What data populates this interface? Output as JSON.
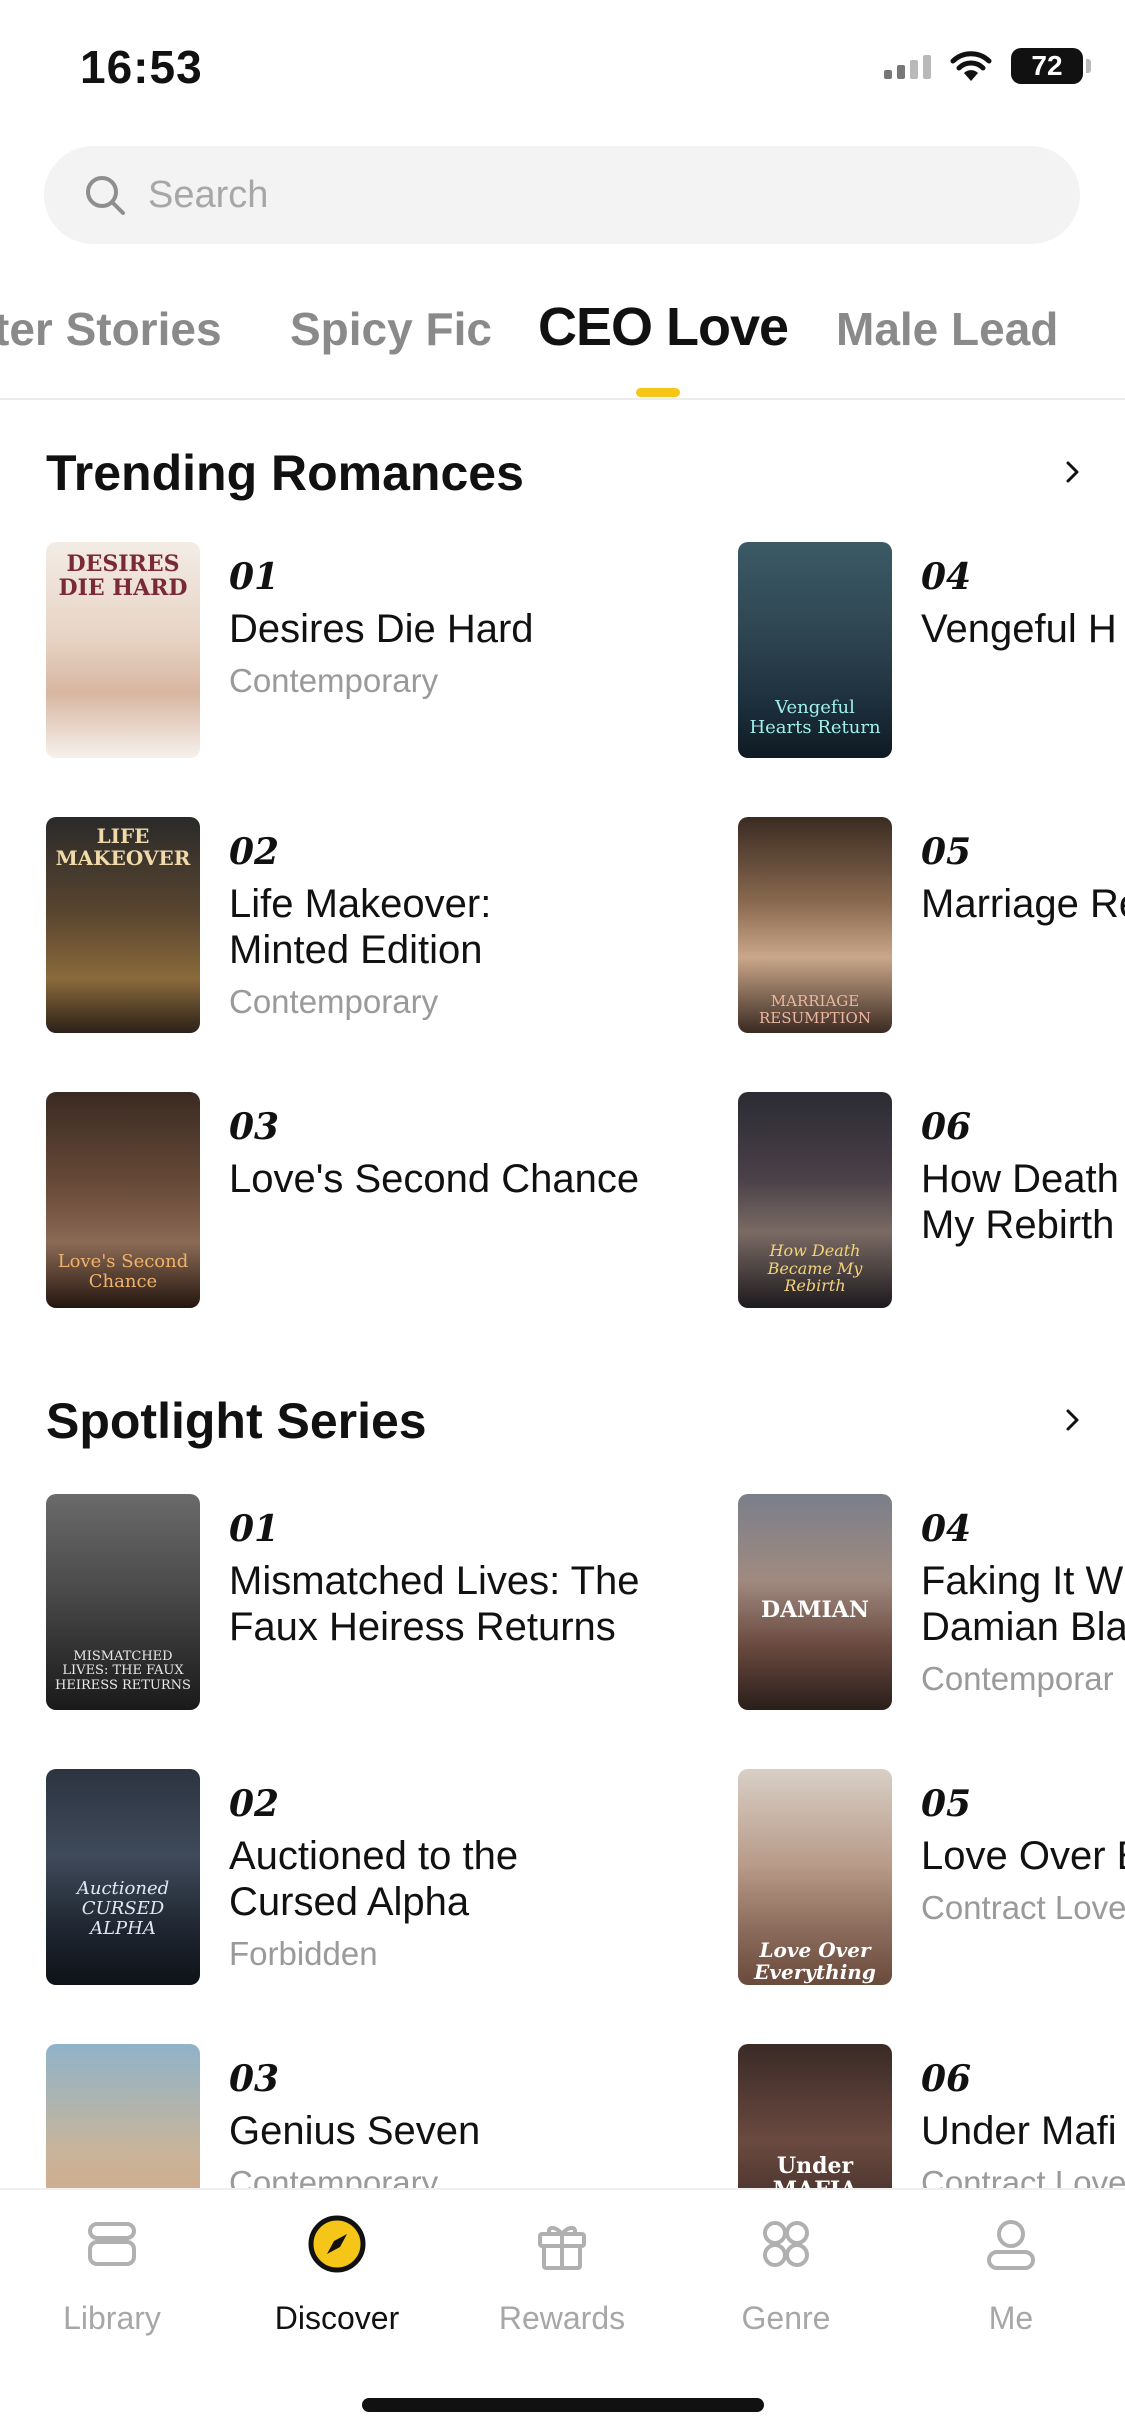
{
  "status": {
    "time": "16:53",
    "battery": "72"
  },
  "search": {
    "placeholder": "Search"
  },
  "tabs": [
    {
      "label": "ter Stories",
      "active": false
    },
    {
      "label": "Spicy Fic",
      "active": false
    },
    {
      "label": "CEO Love",
      "active": true
    },
    {
      "label": "Male Lead",
      "active": false
    }
  ],
  "trending": {
    "title": "Trending Romances",
    "items": [
      {
        "rank": "01",
        "title": "Desires Die Hard",
        "title2": "",
        "genre": "Contemporary",
        "cover_text": "DESIRES DIE HARD"
      },
      {
        "rank": "02",
        "title": "Life Makeover:",
        "title2": "Minted Edition",
        "genre": "Contemporary",
        "cover_text": "LIFE MAKEOVER"
      },
      {
        "rank": "03",
        "title": "Love's Second Chance",
        "title2": "",
        "genre": "",
        "cover_text": "Love's Second Chance"
      },
      {
        "rank": "04",
        "title": "Vengeful H",
        "title2": "",
        "genre": "",
        "cover_text": "Vengeful Hearts Return"
      },
      {
        "rank": "05",
        "title": "Marriage Re",
        "title2": "",
        "genre": "",
        "cover_text": "MARRIAGE RESUMPTION"
      },
      {
        "rank": "06",
        "title": "How Death",
        "title2": "My Rebirth",
        "genre": "",
        "cover_text": "How Death Became My Rebirth"
      }
    ]
  },
  "spotlight": {
    "title": "Spotlight Series",
    "items": [
      {
        "rank": "01",
        "title": "Mismatched Lives: The",
        "title2": "Faux Heiress Returns",
        "genre": "",
        "cover_text": "MISMATCHED LIVES: THE FAUX HEIRESS RETURNS"
      },
      {
        "rank": "02",
        "title": "Auctioned to the",
        "title2": "Cursed Alpha",
        "genre": "Forbidden",
        "cover_text": "Auctioned CURSED ALPHA"
      },
      {
        "rank": "03",
        "title": "Genius Seven",
        "title2": "",
        "genre": "Contemporary",
        "cover_text": ""
      },
      {
        "rank": "04",
        "title": "Faking It W",
        "title2": "Damian Bla",
        "genre": "Contemporar",
        "cover_text": "DAMIAN"
      },
      {
        "rank": "05",
        "title": "Love Over E",
        "title2": "",
        "genre": "Contract Love",
        "cover_text": "Love Over Everything"
      },
      {
        "rank": "06",
        "title": "Under Mafi",
        "title2": "",
        "genre": "Contract Love",
        "cover_text": "Under MAFIA"
      }
    ]
  },
  "nav": [
    {
      "label": "Library",
      "icon": "library-icon",
      "active": false
    },
    {
      "label": "Discover",
      "icon": "compass-icon",
      "active": true
    },
    {
      "label": "Rewards",
      "icon": "gift-icon",
      "active": false
    },
    {
      "label": "Genre",
      "icon": "genre-grid-icon",
      "active": false
    },
    {
      "label": "Me",
      "icon": "profile-icon",
      "active": false
    }
  ],
  "colors": {
    "accent": "#f5c518",
    "muted": "#9a9a9a"
  }
}
